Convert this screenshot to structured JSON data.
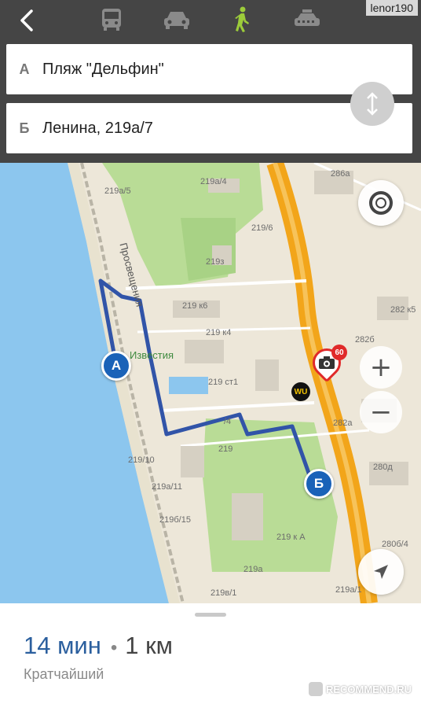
{
  "watermark_user": "lenor190",
  "transport_modes": [
    {
      "name": "bus-icon",
      "active": false
    },
    {
      "name": "car-icon",
      "active": false
    },
    {
      "name": "walk-icon",
      "active": true
    },
    {
      "name": "taxi-icon",
      "active": false
    }
  ],
  "route_from": {
    "letter": "А",
    "value": "Пляж \"Дельфин\""
  },
  "route_to": {
    "letter": "Б",
    "value": "Ленина, 219а/7"
  },
  "map": {
    "street_name": "Просвещения",
    "poi_name": "Известия",
    "pin_start": "А",
    "pin_end": "Б",
    "speed_limit": "60",
    "wu_logo": "WU",
    "building_labels": {
      "l1": "219а/5",
      "l2": "219а/4",
      "l3": "219/6",
      "l4": "219з",
      "l5": "219 к6",
      "l6": "219 к4",
      "l7": "219 ст1",
      "l8": "/4",
      "l9": "219",
      "l10": "219/10",
      "l11": "219а/11",
      "l12": "219б/15",
      "l13": "219 к А",
      "l14": "219а",
      "l15": "219в/1",
      "l16": "219а/1",
      "l17": "286а",
      "l18": "282 к5",
      "l19": "282б",
      "l20": "282а",
      "l21": "280д",
      "l22": "280б/4"
    }
  },
  "summary": {
    "time": "14 мин",
    "separator": "•",
    "distance": "1 км",
    "route_type": "Кратчайший"
  },
  "watermark_site": "RECOMMEND.RU",
  "colors": {
    "accent_blue": "#1a62b8",
    "walk_green": "#9ccc3a",
    "highway_orange": "#f2a51a",
    "water": "#8cc6ee",
    "park": "#b9dc96"
  }
}
